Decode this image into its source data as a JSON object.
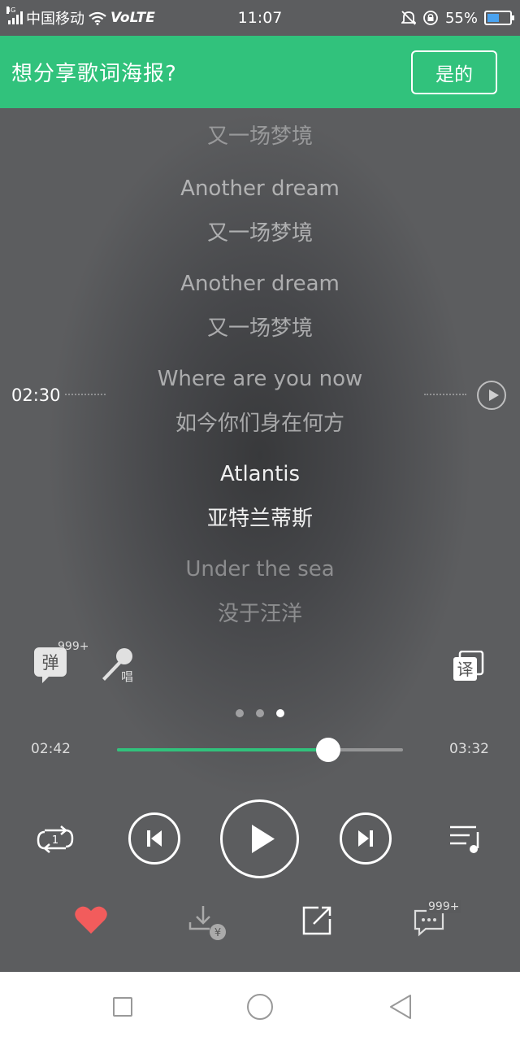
{
  "status_bar": {
    "network_tag": "4G",
    "carrier": "中国移动",
    "volte": "VoLTE",
    "time": "11:07",
    "battery_percent": "55%",
    "battery_level": 0.55
  },
  "share_banner": {
    "prompt": "想分享歌词海报?",
    "confirm_label": "是的"
  },
  "lyrics": [
    {
      "text": "又一场梦境",
      "style": "dim1"
    },
    {
      "text": "Another dream",
      "style": "dim2"
    },
    {
      "text": "又一场梦境",
      "style": "dim2"
    },
    {
      "text": "Another dream",
      "style": "dim2"
    },
    {
      "text": "又一场梦境",
      "style": "dim2"
    },
    {
      "text": "Where are you now",
      "style": "dim2"
    },
    {
      "text": "如今你们身在何方",
      "style": "dim2"
    },
    {
      "text": "Atlantis",
      "style": "bright"
    },
    {
      "text": "亚特兰蒂斯",
      "style": "bright"
    },
    {
      "text": "Under the sea",
      "style": "dim1"
    },
    {
      "text": "没于汪洋",
      "style": "dim1"
    }
  ],
  "seek_time": "02:30",
  "tools": {
    "danmu_label": "弹",
    "danmu_count": "999+",
    "sing_label": "唱",
    "translate_label": "译"
  },
  "pager": {
    "count": 3,
    "active": 2
  },
  "playback": {
    "current": "02:42",
    "total": "03:32",
    "progress_fraction": 0.74
  },
  "actions": {
    "comment_count": "999+",
    "download_badge": "¥"
  },
  "colors": {
    "accent": "#31c27c",
    "like": "#f25c5c"
  }
}
